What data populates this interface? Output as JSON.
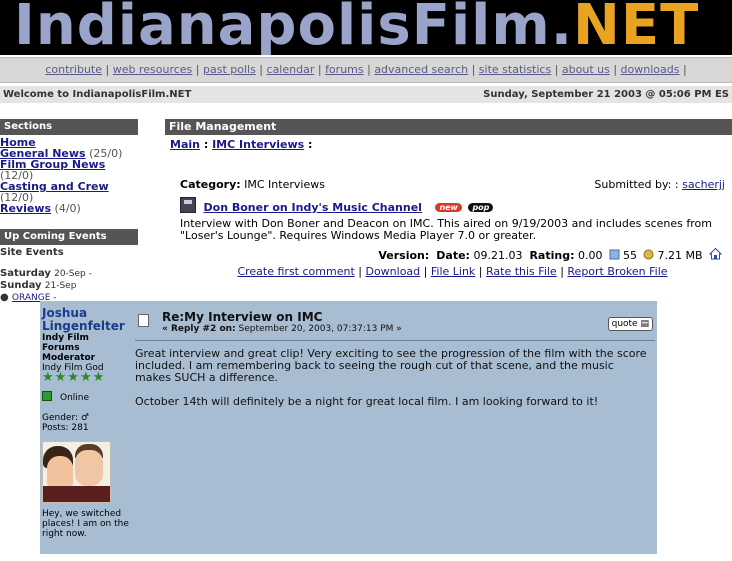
{
  "banner": {
    "logo_main": "IndianapolisFilm.",
    "logo_accent": "NET"
  },
  "nav": [
    "contribute",
    "web resources",
    "past polls",
    "calendar",
    "forums",
    "advanced search",
    "site statistics",
    "about us",
    "downloads"
  ],
  "welcome": {
    "left": "Welcome to IndianapolisFilm.NET",
    "right": "Sunday, September 21 2003 @ 05:06 PM ES"
  },
  "sections": {
    "title": "Sections",
    "items": [
      {
        "label": "Home",
        "count": ""
      },
      {
        "label": "General News",
        "count": "(25/0)"
      },
      {
        "label": "Film Group News",
        "count": "(12/0)"
      },
      {
        "label": "Casting and Crew",
        "count": "(12/0)"
      },
      {
        "label": "Reviews",
        "count": "(4/0)"
      }
    ]
  },
  "events": {
    "title": "Up Coming Events",
    "subtitle": "Site Events",
    "rows": [
      {
        "day": "Saturday",
        "date": "20-Sep -"
      },
      {
        "day": "Sunday",
        "date": "21-Sep"
      }
    ],
    "bullet_link": "ORANGE -"
  },
  "file_management": {
    "header": "File Management",
    "crumb_main": "Main",
    "crumb_sep": ":",
    "crumb_cat": "IMC Interviews",
    "crumb_tail": ":",
    "category_label": "Category:",
    "category_value": "IMC Interviews",
    "submitted_label": "Submitted by: :",
    "submitted_user": "sacherjj",
    "file_title": "Don Boner on Indy's Music Channel",
    "badge_new": "new",
    "badge_pop": "pop",
    "description": "Interview with Don Boner and Deacon on IMC. This aired on 9/19/2003 and includes scenes from \"Loser's Lounge\". Requires Windows Media Player 7.0 or greater.",
    "version_label": "Version:",
    "date_label": "Date:",
    "date_value": "09.21.03",
    "rating_label": "Rating:",
    "rating_value": "0.00",
    "downloads": "55",
    "size": "7.21 MB",
    "actions": [
      "Create first comment",
      "Download",
      "File Link",
      "Rate this File",
      "Report Broken File"
    ]
  },
  "post": {
    "user_first": "Joshua",
    "user_last": "Lingenfelter",
    "title_lines": [
      "Indy Film",
      "Forums",
      "Moderator"
    ],
    "rank": "Indy Film God",
    "stars": "★★★★★",
    "online": "Online",
    "gender": "Gender: ♂",
    "posts": "Posts: 281",
    "signature": "Hey, we switched places! I am on the right now.",
    "subject": "Re:My Interview on IMC",
    "reply_prefix": "« Reply #2 on:",
    "reply_date": "September 20, 2003, 07:37:13 PM »",
    "quote": "quote",
    "body": [
      "Great interview and great clip! Very exciting to see the progression of the film with the score included. I am remembering back to seeing the rough cut of that scene, and the music makes SUCH a difference.",
      "October 14th will definitely be a night for great local film. I am looking forward to it!"
    ]
  }
}
